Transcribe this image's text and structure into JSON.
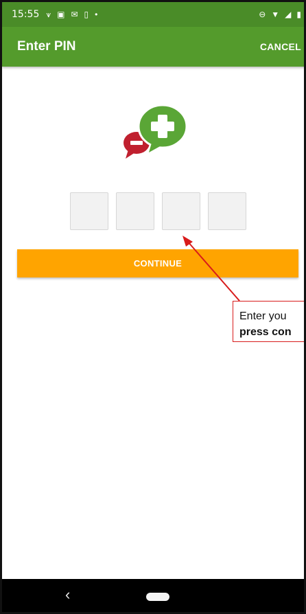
{
  "status_bar": {
    "time": "15:55",
    "icons_left": [
      "signal-icon",
      "sim-icon",
      "mail-icon",
      "battery-saver-icon",
      "dot-icon"
    ],
    "icons_right": [
      "minus-circle-icon",
      "wifi-icon",
      "cell-signal-icon",
      "battery-icon"
    ]
  },
  "app_bar": {
    "title": "Enter PIN",
    "cancel_label": "CANCEL",
    "color": "#549b2c"
  },
  "logo": {
    "icon": "chat-plus-minus-icon",
    "plus_color": "#5aa636",
    "minus_color": "#c0202f"
  },
  "pin": {
    "boxes": [
      "",
      "",
      "",
      ""
    ]
  },
  "continue_button": {
    "label": "CONTINUE",
    "color": "#ffa400"
  },
  "annotation": {
    "line1": "Enter you",
    "line2": "press con",
    "color": "#d81b1b"
  },
  "nav_bar": {
    "back_icon": "back-chevron-icon",
    "home_icon": "home-pill-icon"
  }
}
